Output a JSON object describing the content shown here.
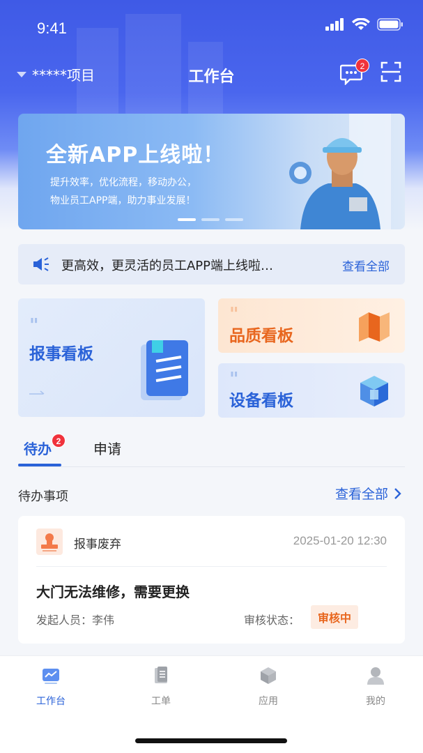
{
  "status_bar": {
    "time": "9:41"
  },
  "nav": {
    "project": "*****项目",
    "title": "工作台",
    "message_badge": "2"
  },
  "banner": {
    "title": "全新APP上线啦！",
    "subtitle_line1": "提升效率，优化流程，移动办公，",
    "subtitle_line2": "物业员工APP端，助力事业发展！",
    "slides": 3,
    "active_slide": 1
  },
  "notice": {
    "text": "更高效，更灵活的员工APP端上线啦…",
    "more": "查看全部"
  },
  "boards": {
    "baoshi": "报事看板",
    "pinzhi": "品质看板",
    "shebei": "设备看板"
  },
  "tabs": {
    "todo": "待办",
    "todo_badge": "2",
    "apply": "申请"
  },
  "todo": {
    "title": "待办事项",
    "more": "查看全部",
    "items": [
      {
        "type": "报事废弃",
        "time": "2025-01-20 12:30",
        "subject": "大门无法维修，需要更换",
        "initiator": "发起人员：李伟",
        "status_label": "审核状态：",
        "status": "审核中"
      }
    ]
  },
  "tabbar": {
    "items": [
      {
        "label": "工作台",
        "icon": "dashboard-icon",
        "active": true
      },
      {
        "label": "工单",
        "icon": "work-order-icon",
        "active": false
      },
      {
        "label": "应用",
        "icon": "apps-cube-icon",
        "active": false
      },
      {
        "label": "我的",
        "icon": "profile-icon",
        "active": false
      }
    ]
  },
  "colors": {
    "primary": "#2a62d8",
    "header_gradient_top": "#3f5ae6",
    "badge_red": "#f0323c",
    "orange": "#e8661e"
  }
}
